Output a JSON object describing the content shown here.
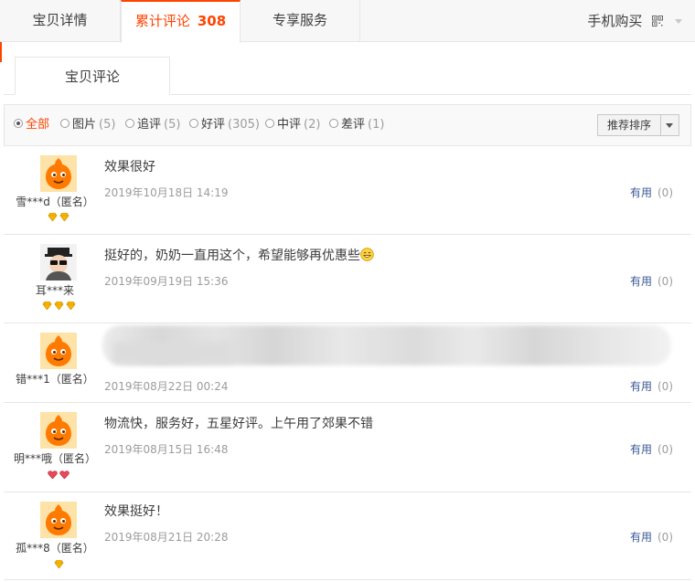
{
  "tabs": {
    "details": "宝贝详情",
    "reviews_label": "累计评论",
    "reviews_count": "308",
    "service": "专享服务",
    "mobile": "手机购买"
  },
  "subtab": "宝贝评论",
  "filters": [
    {
      "label": "全部",
      "count": ""
    },
    {
      "label": "图片",
      "count": "(5)"
    },
    {
      "label": "追评",
      "count": "(5)"
    },
    {
      "label": "好评",
      "count": "(305)"
    },
    {
      "label": "中评",
      "count": "(2)"
    },
    {
      "label": "差评",
      "count": "(1)"
    }
  ],
  "sort_label": "推荐排序",
  "useful_label": "有用",
  "reviews": [
    {
      "user": "雪***d（匿名）",
      "text": "效果很好",
      "date": "2019年10月18日 14:19",
      "useful": "(0)",
      "badge": "gold",
      "badge_count": 2
    },
    {
      "user": "耳***来",
      "text": "挺好的，奶奶一直用这个，希望能够再优惠些",
      "date": "2019年09月19日 15:36",
      "useful": "(0)",
      "badge": "gold",
      "badge_count": 3
    },
    {
      "user": "错***1（匿名）",
      "text": "",
      "date": "2019年08月22日 00:24",
      "useful": "(0)",
      "badge": "none",
      "badge_count": 0
    },
    {
      "user": "明***哦（匿名）",
      "text": "物流快，服务好，五星好评。上午用了郊果不错",
      "date": "2019年08月15日 16:48",
      "useful": "(0)",
      "badge": "red",
      "badge_count": 2
    },
    {
      "user": "孤***8（匿名）",
      "text": "效果挺好！",
      "date": "2019年08月21日 20:28",
      "useful": "(0)",
      "badge": "gold",
      "badge_count": 1
    }
  ],
  "colors": {
    "accent": "#ff4400",
    "link": "#3b5998",
    "muted": "#9c9c9c",
    "border": "#e6e6e6"
  }
}
